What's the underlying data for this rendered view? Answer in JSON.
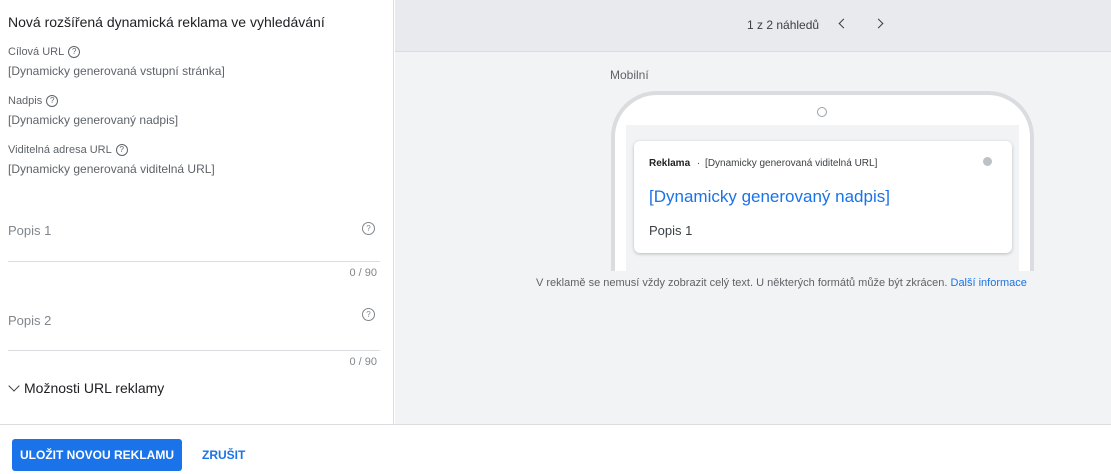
{
  "form": {
    "title": "Nová rozšířená dynamická reklama ve vyhledávání",
    "fields": [
      {
        "label": "Cílová URL",
        "value": "[Dynamicky generovaná vstupní stránka]"
      },
      {
        "label": "Nadpis",
        "value": "[Dynamicky generovaný nadpis]"
      },
      {
        "label": "Viditelná adresa URL",
        "value": "[Dynamicky generovaná viditelná URL]"
      }
    ],
    "inputs": [
      {
        "label": "Popis 1",
        "counter": "0 / 90"
      },
      {
        "label": "Popis 2",
        "counter": "0 / 90"
      }
    ],
    "url_options": "Možnosti URL reklamy"
  },
  "preview": {
    "pager": "1 z 2 náhledů",
    "device_label": "Mobilní",
    "ad": {
      "badge": "Reklama",
      "separator": "·",
      "display_url": "[Dynamicky generovaná viditelná URL]",
      "headline": "[Dynamicky generovaný nadpis]",
      "description": "Popis 1"
    },
    "disclaimer": "V reklamě se nemusí vždy zobrazit celý text. U některých formátů může být zkrácen.",
    "learn_more": "Další informace"
  },
  "footer": {
    "save_label": "ULOŽIT NOVOU REKLAMU",
    "cancel_label": "ZRUŠIT"
  },
  "icons": {
    "help": "?"
  }
}
